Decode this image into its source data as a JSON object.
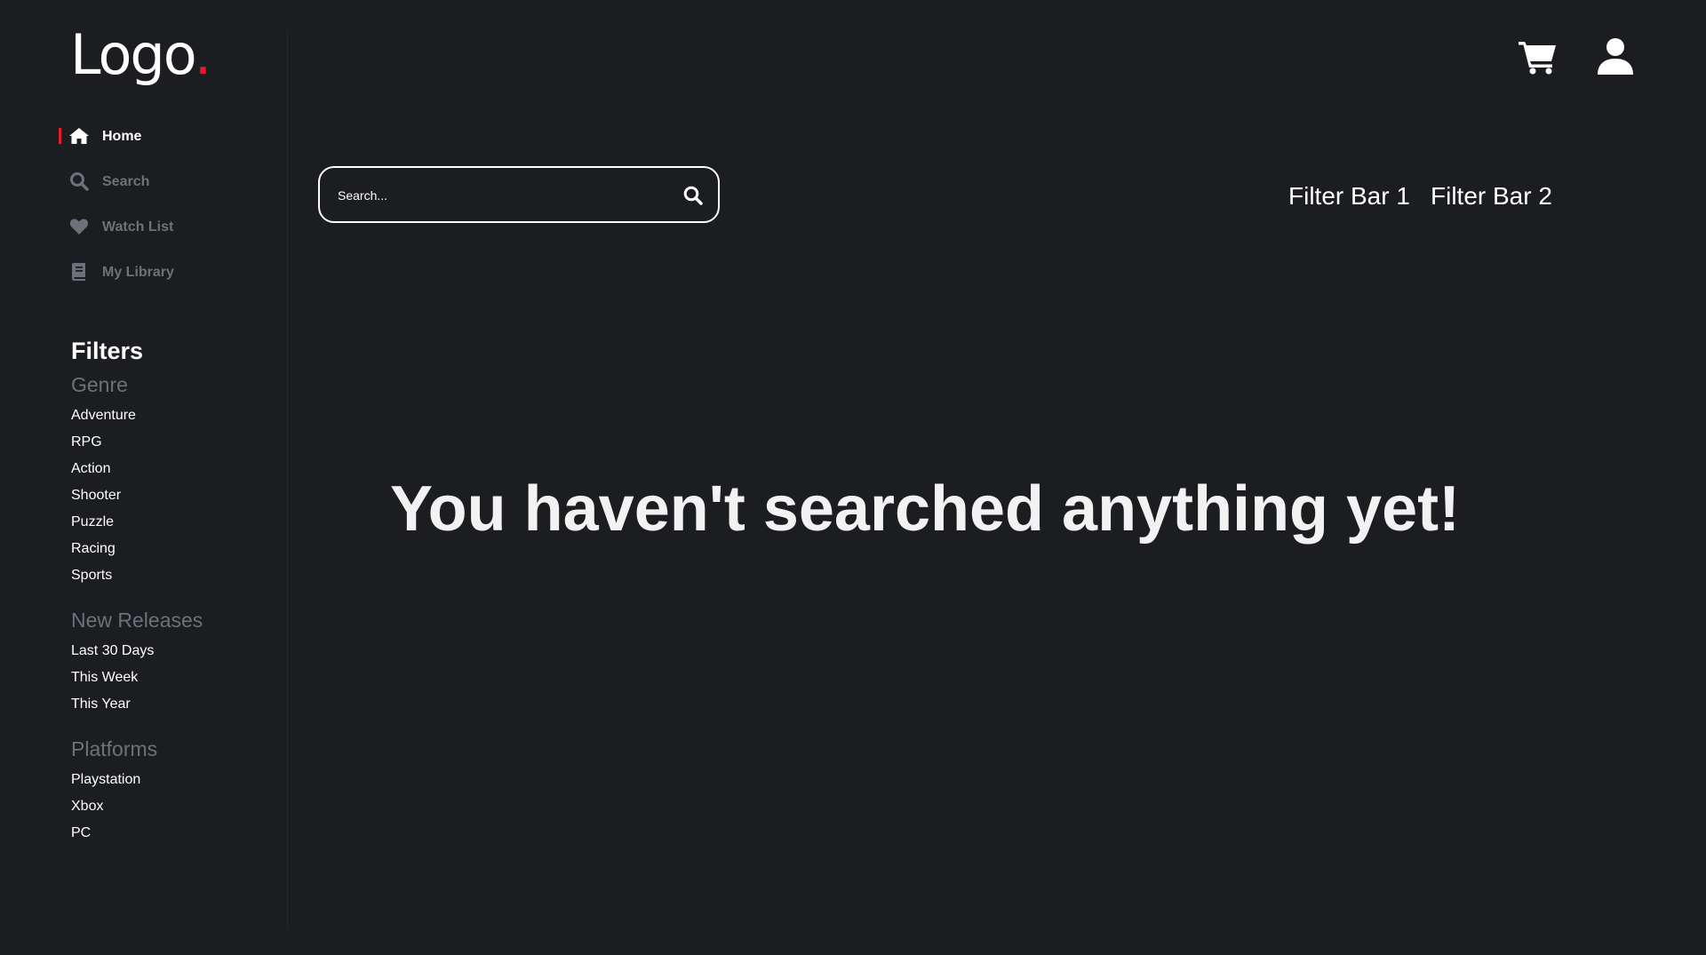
{
  "logo": {
    "text": "Logo",
    "dot": "."
  },
  "nav": {
    "items": [
      {
        "label": "Home",
        "icon": "home-icon",
        "active": true
      },
      {
        "label": "Search",
        "icon": "search-icon",
        "active": false
      },
      {
        "label": "Watch List",
        "icon": "heart-icon",
        "active": false
      },
      {
        "label": "My Library",
        "icon": "book-icon",
        "active": false
      }
    ]
  },
  "filters": {
    "title": "Filters",
    "genre": {
      "heading": "Genre",
      "items": [
        "Adventure",
        "RPG",
        "Action",
        "Shooter",
        "Puzzle",
        "Racing",
        "Sports"
      ]
    },
    "new_releases": {
      "heading": "New Releases",
      "items": [
        "Last 30 Days",
        "This Week",
        "This Year"
      ]
    },
    "platforms": {
      "heading": "Platforms",
      "items": [
        "Playstation",
        "Xbox",
        "PC"
      ]
    }
  },
  "header": {
    "cart_icon": "cart-icon",
    "user_icon": "user-icon"
  },
  "search": {
    "placeholder": "Search...",
    "value": "",
    "button_icon": "search-icon"
  },
  "filter_bars": {
    "bar1": "Filter Bar 1",
    "bar2": "Filter Bar 2"
  },
  "empty_state": {
    "message": "You haven't searched anything yet!"
  },
  "colors": {
    "background": "#1c1d21",
    "accent": "#e6192e",
    "muted_text": "#6f7078",
    "text": "#ffffff"
  }
}
